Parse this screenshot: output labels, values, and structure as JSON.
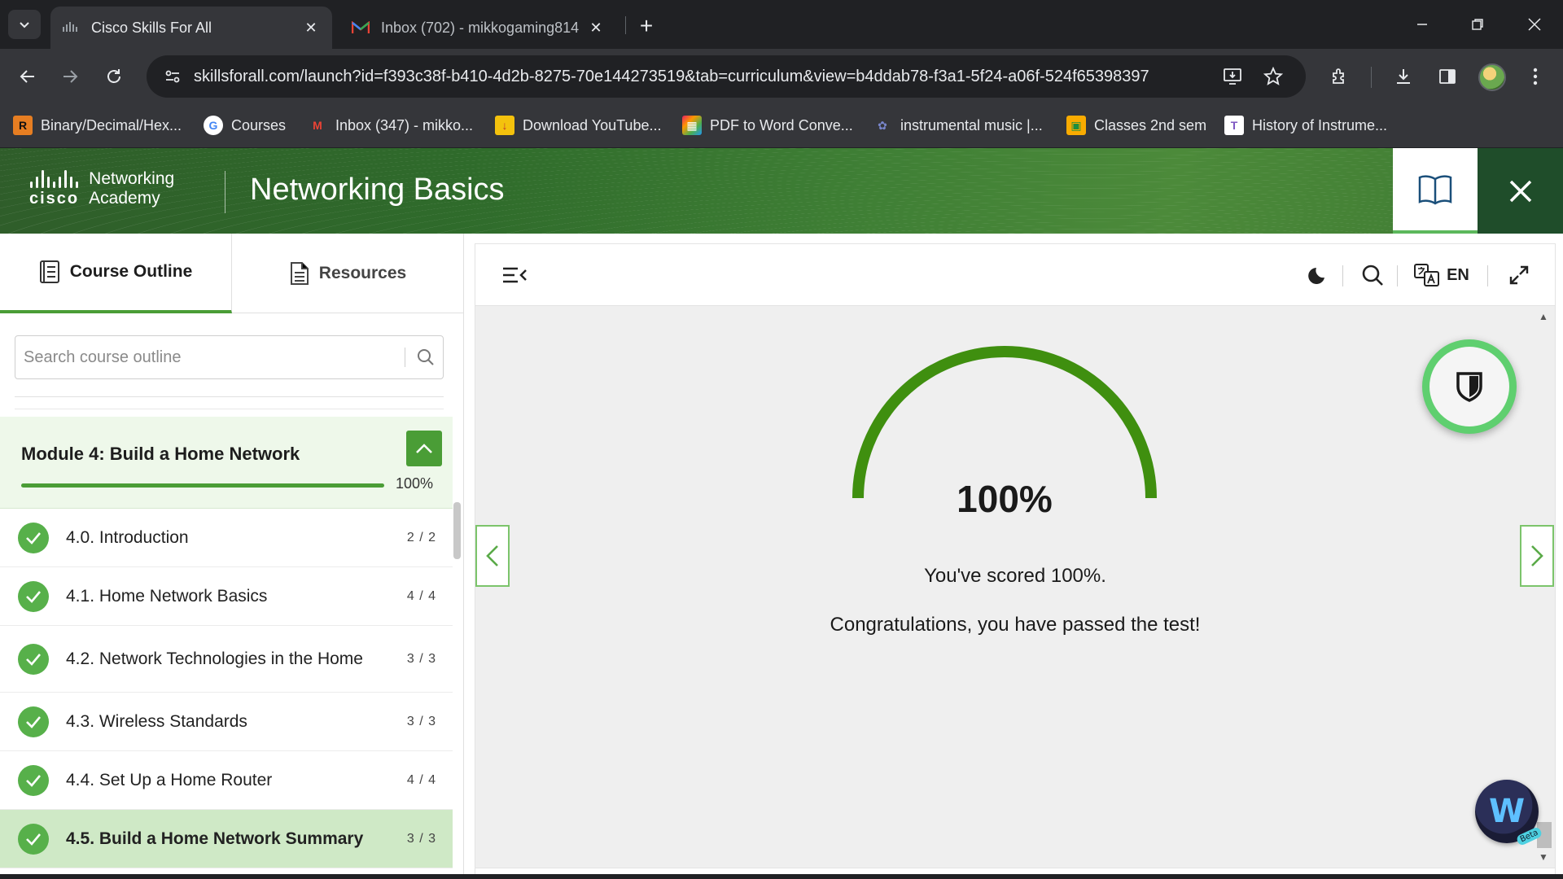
{
  "browser": {
    "active_tab": {
      "title": "Cisco Skills For All",
      "favicon": "cisco-icon"
    },
    "inactive_tab": {
      "title": "Inbox (702) - mikkogaming814",
      "favicon": "gmail-icon"
    },
    "url": "skillsforall.com/launch?id=f393c38f-b410-4d2b-8275-70e144273519&tab=curriculum&view=b4ddab78-f3a1-5f24-a06f-524f65398397",
    "bookmarks": [
      {
        "label": "Binary/Decimal/Hex...",
        "icon": "R",
        "color": "#e67e22"
      },
      {
        "label": "Courses",
        "icon": "G",
        "color": "#ffffff"
      },
      {
        "label": "Inbox (347) - mikko...",
        "icon": "M",
        "color": "#ea4335"
      },
      {
        "label": "Download YouTube...",
        "icon": "↓",
        "color": "#f4c20d"
      },
      {
        "label": "PDF to Word Conve...",
        "icon": "▦",
        "color": "#e91e63"
      },
      {
        "label": "instrumental music |...",
        "icon": "✿",
        "color": "#5c6bc0"
      },
      {
        "label": "Classes 2nd sem",
        "icon": "▣",
        "color": "#f9ab00"
      },
      {
        "label": "History of Instrume...",
        "icon": "T",
        "color": "#7e57c2"
      }
    ]
  },
  "header": {
    "logo_line1": "Networking",
    "logo_line2": "Academy",
    "logo_word": "cisco",
    "course_title": "Networking Basics"
  },
  "sidebar": {
    "tabs": [
      {
        "label": "Course Outline",
        "icon": "outline-icon"
      },
      {
        "label": "Resources",
        "icon": "document-icon"
      }
    ],
    "search_placeholder": "Search course outline",
    "module": {
      "title": "Module 4: Build a Home Network",
      "progress_percent": 100,
      "progress_label": "100%"
    },
    "items": [
      {
        "label": "4.0. Introduction",
        "count": "2 / 2",
        "completed": true,
        "current": false
      },
      {
        "label": "4.1. Home Network Basics",
        "count": "4 / 4",
        "completed": true,
        "current": false
      },
      {
        "label": "4.2. Network Technologies in the Home",
        "count": "3 / 3",
        "completed": true,
        "current": false
      },
      {
        "label": "4.3. Wireless Standards",
        "count": "3 / 3",
        "completed": true,
        "current": false
      },
      {
        "label": "4.4. Set Up a Home Router",
        "count": "4 / 4",
        "completed": true,
        "current": false
      },
      {
        "label": "4.5. Build a Home Network Summary",
        "count": "3 / 3",
        "completed": true,
        "current": true
      }
    ]
  },
  "content": {
    "language": "EN",
    "score_percent": 100,
    "score_label": "100%",
    "score_message": "You've scored 100%.",
    "congrats_message": "Congratulations, you have passed the test!",
    "beta_label": "Beta"
  },
  "colors": {
    "accent_green": "#4a9d36",
    "header_green": "#2f6b2b",
    "progress_arc": "#3f8f0f"
  }
}
